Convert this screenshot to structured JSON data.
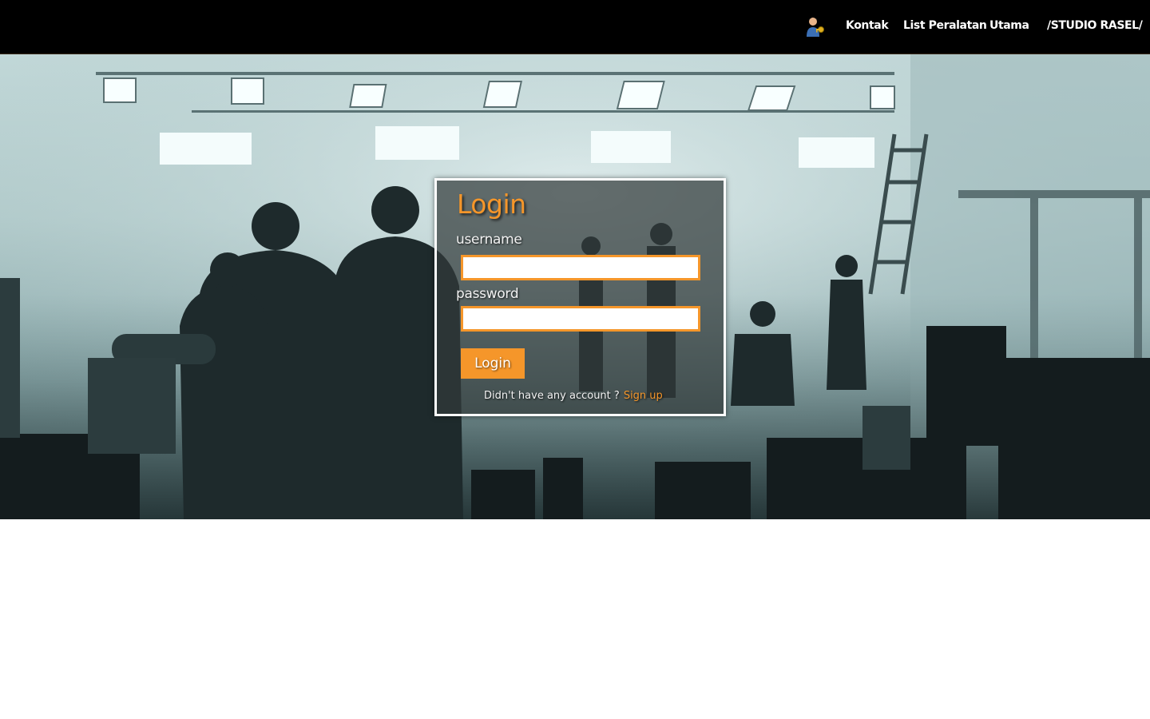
{
  "navbar": {
    "icon": "user-key-icon",
    "links": {
      "kontak": "Kontak",
      "list_peralatan": "List Peralatan",
      "utama": "Utama",
      "brand": "/STUDIO RASEL/"
    }
  },
  "hero": {
    "image": "film-studio-crew-silhouettes"
  },
  "login": {
    "title": "Login",
    "username_label": "username",
    "username_value": "",
    "password_label": "password",
    "password_value": "",
    "button_label": "Login",
    "signup_prompt": "Didn't have any account ?",
    "signup_link": "Sign up"
  },
  "colors": {
    "accent": "#f5962a",
    "navbar_bg": "#000000",
    "page_bg": "#ffffff"
  }
}
